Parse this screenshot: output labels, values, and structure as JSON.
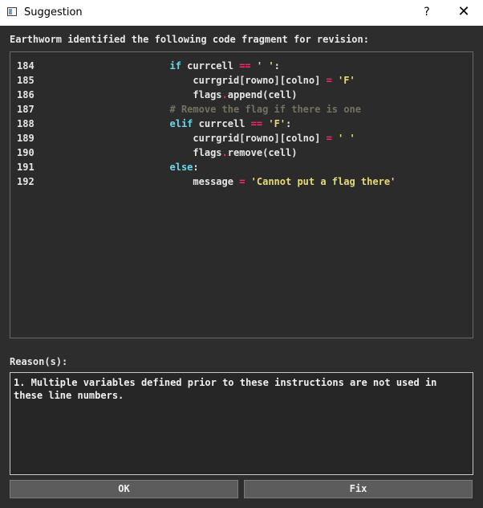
{
  "window": {
    "title": "Suggestion",
    "help_glyph": "?",
    "close_glyph": "✕"
  },
  "code_label": "Earthworm identified the following code fragment for revision:",
  "code_lines": [
    {
      "num": "184",
      "tokens": [
        [
          "",
          "                    "
        ],
        [
          "kw",
          "if"
        ],
        [
          "",
          " currcell "
        ],
        [
          "op",
          "=="
        ],
        [
          "",
          " "
        ],
        [
          "str",
          "' '"
        ],
        [
          "",
          ":"
        ]
      ]
    },
    {
      "num": "185",
      "tokens": [
        [
          "",
          "                        currgrid[rowno][colno] "
        ],
        [
          "op",
          "="
        ],
        [
          "",
          " "
        ],
        [
          "str",
          "'F'"
        ]
      ]
    },
    {
      "num": "186",
      "tokens": [
        [
          "",
          "                        flags"
        ],
        [
          "op",
          "."
        ],
        [
          "",
          "append(cell)"
        ]
      ]
    },
    {
      "num": "187",
      "tokens": [
        [
          "",
          "                    "
        ],
        [
          "cmt",
          "# Remove the flag if there is one"
        ]
      ]
    },
    {
      "num": "188",
      "tokens": [
        [
          "",
          "                    "
        ],
        [
          "kw",
          "elif"
        ],
        [
          "",
          " currcell "
        ],
        [
          "op",
          "=="
        ],
        [
          "",
          " "
        ],
        [
          "str",
          "'F'"
        ],
        [
          "",
          ":"
        ]
      ]
    },
    {
      "num": "189",
      "tokens": [
        [
          "",
          "                        currgrid[rowno][colno] "
        ],
        [
          "op",
          "="
        ],
        [
          "",
          " "
        ],
        [
          "str",
          "' '"
        ]
      ]
    },
    {
      "num": "190",
      "tokens": [
        [
          "",
          "                        flags"
        ],
        [
          "op",
          "."
        ],
        [
          "",
          "remove(cell)"
        ]
      ]
    },
    {
      "num": "191",
      "tokens": [
        [
          "",
          "                    "
        ],
        [
          "kw",
          "else"
        ],
        [
          "",
          ":"
        ]
      ]
    },
    {
      "num": "192",
      "tokens": [
        [
          "",
          "                        message "
        ],
        [
          "op",
          "="
        ],
        [
          "",
          " "
        ],
        [
          "str",
          "'Cannot put a flag there'"
        ]
      ]
    }
  ],
  "reason_label": "Reason(s):",
  "reason_text": "1. Multiple variables defined prior to these instructions are not used in these line numbers.",
  "buttons": {
    "ok": "OK",
    "fix": "Fix"
  },
  "colors": {
    "keyword": "#66d9ef",
    "operator": "#f92672",
    "string": "#e6db74",
    "comment": "#75715e",
    "background": "#2d2d2d"
  }
}
